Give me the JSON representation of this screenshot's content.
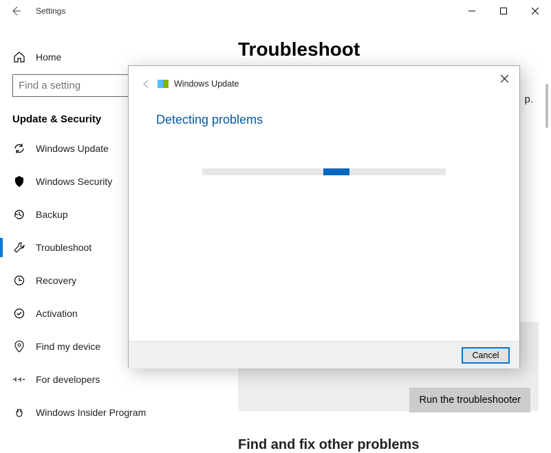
{
  "window": {
    "title": "Settings",
    "controls": {
      "minimize": "–",
      "maximize": "□",
      "close": "✕"
    }
  },
  "sidebar": {
    "home": "Home",
    "search_placeholder": "Find a setting",
    "section": "Update & Security",
    "items": [
      {
        "label": "Windows Update",
        "icon": "sync-icon"
      },
      {
        "label": "Windows Security",
        "icon": "shield-icon"
      },
      {
        "label": "Backup",
        "icon": "history-icon"
      },
      {
        "label": "Troubleshoot",
        "icon": "wrench-icon",
        "active": true
      },
      {
        "label": "Recovery",
        "icon": "restore-icon"
      },
      {
        "label": "Activation",
        "icon": "check-circle-icon"
      },
      {
        "label": "Find my device",
        "icon": "location-icon"
      },
      {
        "label": "For developers",
        "icon": "code-icon"
      },
      {
        "label": "Windows Insider Program",
        "icon": "bug-icon"
      }
    ]
  },
  "content": {
    "page_title": "Troubleshoot",
    "truncated_suffix": "p.",
    "run_button": "Run the troubleshooter",
    "subheader": "Find and fix other problems"
  },
  "modal": {
    "troubleshooter_name": "Windows Update",
    "status": "Detecting problems",
    "cancel": "Cancel"
  }
}
